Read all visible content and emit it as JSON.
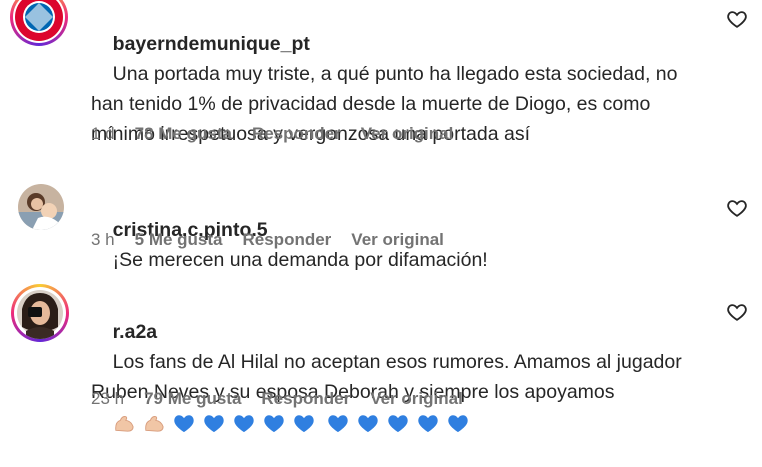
{
  "comments": [
    {
      "username": "bayerndemunique_pt",
      "text": "Una portada muy triste, a qué punto ha llegado esta sociedad, no han tenido 1% de privacidad desde la muerte de Diogo, es como mínimo irrespetuosa y vergonzosa una portada así",
      "time": "1 d",
      "likes": "78 Me gusta",
      "reply": "Responder",
      "original": "Ver original",
      "avatar_icon": "bayern-munich-crest-icon"
    },
    {
      "username": "cristina.c.pinto.5",
      "text": "¡Se merecen una demanda por difamación!",
      "time": "3 h",
      "likes": "5 Me gusta",
      "reply": "Responder",
      "original": "Ver original",
      "avatar_icon": "user-photo-icon"
    },
    {
      "username": "r.a2a",
      "text": "Los fans de Al Hilal no aceptan esos rumores. Amamos al jugador Ruben Neves y su esposa Deborah y siempre los apoyamos",
      "time": "23 h",
      "likes": "79 Me gusta",
      "reply": "Responder",
      "original": "Ver original",
      "avatar_icon": "user-photo-icon",
      "emojis": [
        "flexed-biceps",
        "flexed-biceps",
        "blue-heart",
        "blue-heart",
        "blue-heart",
        "blue-heart",
        "blue-heart",
        "blue-heart",
        "blue-heart",
        "blue-heart",
        "blue-heart",
        "blue-heart"
      ]
    }
  ],
  "colors": {
    "text": "#262626",
    "meta": "#737373",
    "blue_heart": "#2f7fe0",
    "skin": "#f1c6a6"
  }
}
